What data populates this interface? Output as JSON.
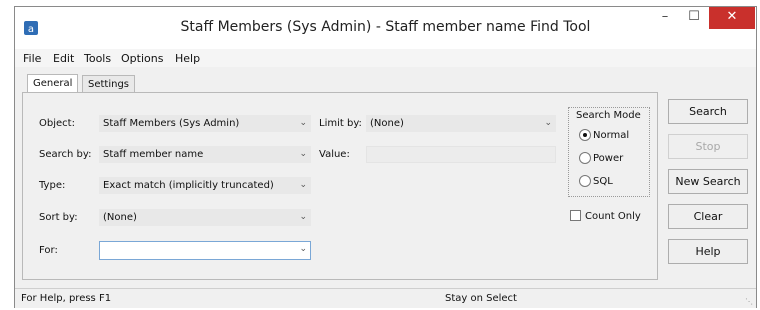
{
  "window": {
    "title": "Staff Members (Sys Admin) - Staff member name Find Tool",
    "minimize": "–",
    "maximize": "☐",
    "close": "✕"
  },
  "menu": [
    "File",
    "Edit",
    "Tools",
    "Options",
    "Help"
  ],
  "tabs": [
    {
      "label": "General",
      "active": true
    },
    {
      "label": "Settings",
      "active": false
    }
  ],
  "form": {
    "object_label": "Object:",
    "object_value": "Staff Members (Sys Admin)",
    "search_by_label": "Search by:",
    "search_by_value": "Staff member name",
    "type_label": "Type:",
    "type_value": "Exact match (implicitly truncated)",
    "sort_by_label": "Sort by:",
    "sort_by_value": "(None)",
    "for_label": "For:",
    "for_value": "",
    "limit_by_label": "Limit by:",
    "limit_by_value": "(None)",
    "value_label": "Value:",
    "value_value": ""
  },
  "search_mode": {
    "title": "Search Mode",
    "options": [
      {
        "label": "Normal",
        "selected": true
      },
      {
        "label": "Power",
        "selected": false
      },
      {
        "label": "SQL",
        "selected": false
      }
    ]
  },
  "count_only": {
    "label": "Count Only",
    "checked": false
  },
  "buttons": {
    "search": "Search",
    "stop": "Stop",
    "new_search": "New Search",
    "clear": "Clear",
    "help": "Help"
  },
  "status": {
    "left": "For Help, press F1",
    "middle": "Stay on Select"
  },
  "icons": {
    "dropdown": "chevron-down-icon",
    "app": "app-icon",
    "grip": "resize-grip-icon"
  }
}
